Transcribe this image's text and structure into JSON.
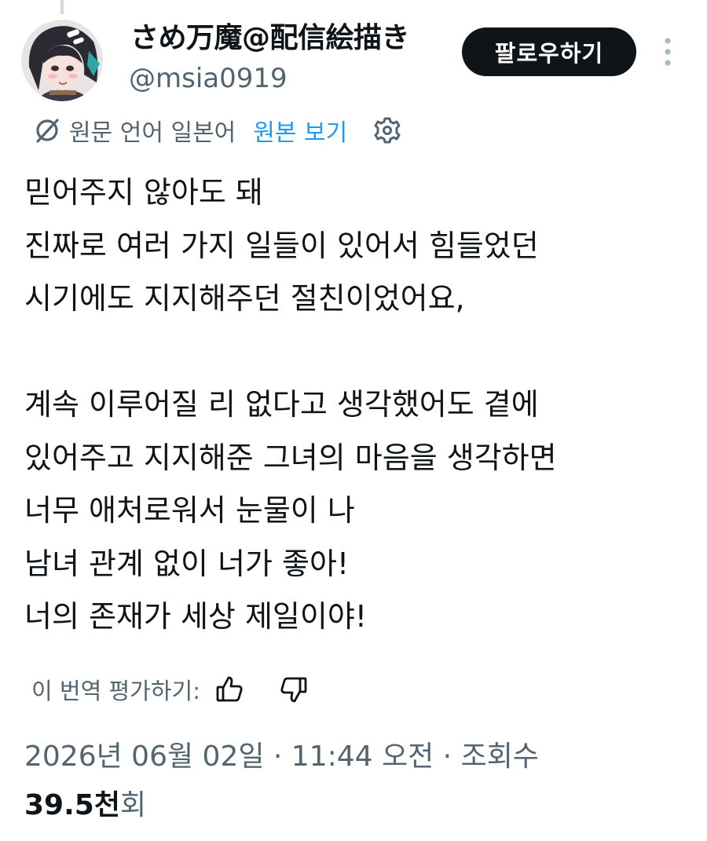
{
  "author": {
    "display_name": "さめ万魔@配信絵描き",
    "handle": "@msia0919"
  },
  "header": {
    "follow_label": "팔로우하기"
  },
  "translation": {
    "source_language_text": "원문 언어 일본어",
    "view_original_label": "원본 보기"
  },
  "tweet": {
    "lines": [
      "믿어주지 않아도 돼",
      "진짜로 여러 가지 일들이 있어서 힘들었던",
      "시기에도 지지해주던 절친이었어요,",
      "",
      "계속 이루어질 리 없다고 생각했어도 곁에",
      "있어주고 지지해준 그녀의 마음을 생각하면",
      "너무 애처로워서 눈물이 나",
      "남녀 관계 없이 너가 좋아!",
      "너의 존재가 세상 제일이야!"
    ]
  },
  "rating": {
    "label": "이 번역 평가하기:"
  },
  "meta": {
    "timestamp_line": "2026년 06월 02일 · 11:44 오전 · 조회수",
    "views_count": "39.5천",
    "views_suffix": "회"
  },
  "colors": {
    "text_primary": "#0f1419",
    "text_secondary": "#536471",
    "accent_blue": "#1d9bf0",
    "follow_button_bg": "#0f1419"
  },
  "icons": {
    "more": "more-vertical-icon",
    "translate": "translate-icon",
    "settings": "gear-icon",
    "thumb_up": "thumb-up-icon",
    "thumb_down": "thumb-down-icon"
  }
}
